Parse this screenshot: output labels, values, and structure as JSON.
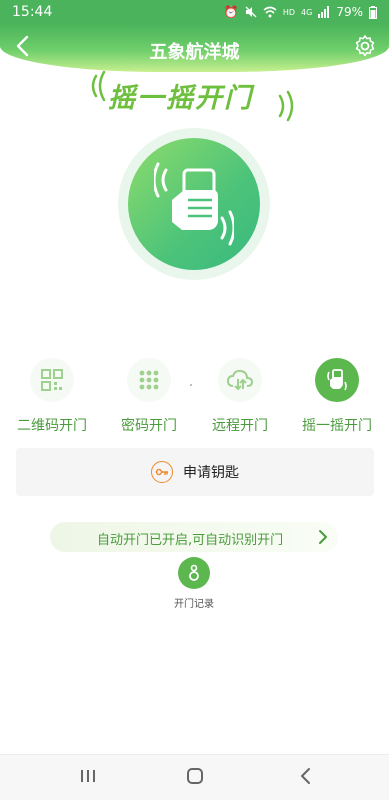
{
  "status_bar": {
    "time": "15:44",
    "net_label": "HD",
    "network_type": "4G",
    "battery": "79%",
    "icons": [
      "alarm-icon",
      "mute-icon",
      "wifi-icon",
      "signal-icon",
      "battery-icon"
    ]
  },
  "header": {
    "title": "五象航洋城",
    "left_icon": "back-arrow-icon",
    "right_icon": "settings-gear-icon"
  },
  "shake": {
    "title": "摇一摇开门"
  },
  "modes": [
    {
      "label": "二维码开门",
      "icon": "qr-code-icon",
      "active": false
    },
    {
      "label": "密码开门",
      "icon": "keypad-icon",
      "active": false
    },
    {
      "label": "远程开门",
      "icon": "cloud-icon",
      "active": false
    },
    {
      "label": "摇一摇开门",
      "icon": "shake-phone-icon",
      "active": true
    }
  ],
  "apply_key": {
    "label": "申请钥匙",
    "icon": "key-icon"
  },
  "auto_open": {
    "text": "自动开门已开启,可自动识别开门",
    "icon": "chevron-right-icon"
  },
  "record": {
    "label": "开门记录",
    "icon": "key-ring-icon"
  },
  "nav_bar": {
    "icons": [
      "recent-apps-icon",
      "home-icon",
      "back-icon"
    ]
  },
  "colors": {
    "brand_green": "#4bb35b",
    "accent_light_green": "#6fbf3f",
    "key_orange": "#f08a2a"
  }
}
